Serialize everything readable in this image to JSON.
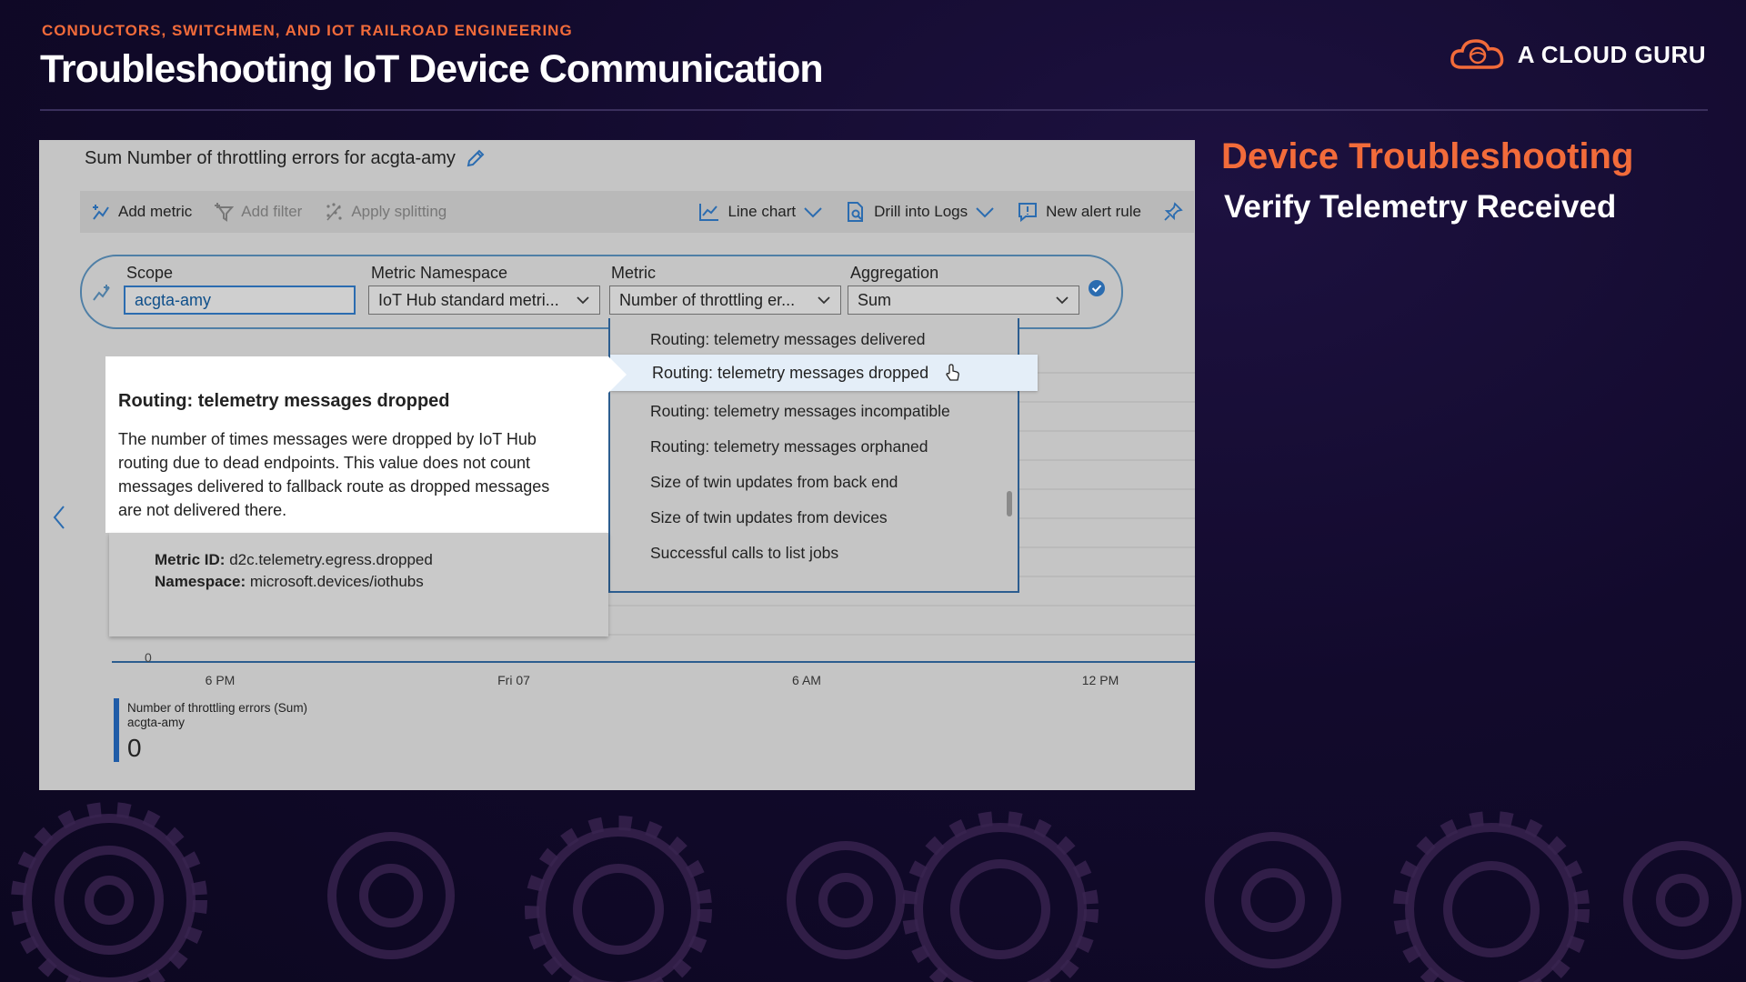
{
  "slide": {
    "kicker": "CONDUCTORS, SWITCHMEN, AND IOT RAILROAD ENGINEERING",
    "title": "Troubleshooting IoT Device Communication",
    "brand": "A CLOUD GURU",
    "side_title": "Device Troubleshooting",
    "side_subtitle": "Verify Telemetry Received",
    "accent_color": "#f26b3a"
  },
  "chart_header": {
    "title": "Sum Number of throttling errors for acgta-amy",
    "edit_icon": "pencil-icon"
  },
  "toolbar": {
    "add_metric": "Add metric",
    "add_filter": "Add filter",
    "apply_splitting": "Apply splitting",
    "line_chart": "Line chart",
    "drill_into_logs": "Drill into Logs",
    "new_alert_rule": "New alert rule"
  },
  "metric_selector": {
    "scope_label": "Scope",
    "scope_value": "acgta-amy",
    "namespace_label": "Metric Namespace",
    "namespace_value": "IoT Hub standard metri...",
    "metric_label": "Metric",
    "metric_value": "Number of throttling er...",
    "aggregation_label": "Aggregation",
    "aggregation_value": "Sum"
  },
  "metric_dropdown": {
    "items": [
      "Routing: telemetry messages delivered",
      "Routing: telemetry messages dropped",
      "Routing: telemetry messages incompatible",
      "Routing: telemetry messages orphaned",
      "Size of twin updates from back end",
      "Size of twin updates from devices",
      "Successful calls to list jobs"
    ],
    "highlighted": "Routing: telemetry messages dropped"
  },
  "tooltip": {
    "title": "Routing: telemetry messages dropped",
    "description": "The number of times messages were dropped by IoT Hub routing due to dead endpoints. This value does not count messages delivered to fallback route as dropped messages are not delivered there.",
    "metric_id_label": "Metric ID:",
    "metric_id": "d2c.telemetry.egress.dropped",
    "namespace_label": "Namespace:",
    "namespace": "microsoft.devices/iothubs"
  },
  "chart_data": {
    "type": "line",
    "x_ticks": [
      "6 PM",
      "Fri 07",
      "6 AM",
      "12 PM"
    ],
    "y_tick_labels": [
      "0"
    ],
    "series": [
      {
        "name": "Number of throttling errors (Sum)",
        "values": [
          0,
          0,
          0,
          0
        ]
      }
    ],
    "legend": {
      "series_name": "Number of throttling errors (Sum)",
      "resource": "acgta-amy",
      "value": "0"
    }
  }
}
